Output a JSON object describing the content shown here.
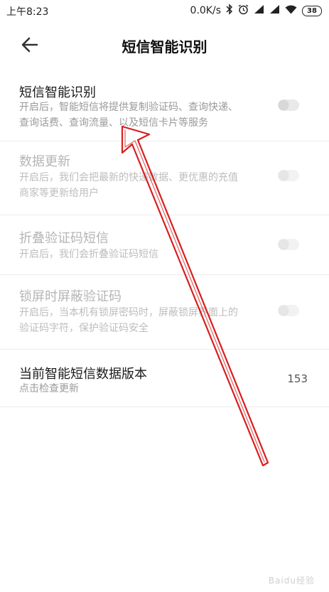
{
  "status_bar": {
    "time": "上午8:23",
    "network_speed": "0.0K/s",
    "battery": "38",
    "icons": [
      "bluetooth-icon",
      "alarm-icon",
      "signal-icon",
      "signal-icon",
      "wifi-icon",
      "battery-icon"
    ]
  },
  "header": {
    "title": "短信智能识别",
    "back_icon": "back-arrow-icon"
  },
  "settings": [
    {
      "title": "短信智能识别",
      "desc_line1": "开启后，智能短信将提供复制验证码、查询快递、",
      "desc_line2": "查询话费、查询流量、以及短信卡片等服务",
      "enabled": true,
      "toggle_on": false
    },
    {
      "title": "数据更新",
      "desc_line1": "开启后，我们会把最新的快递数据、更优惠的充值",
      "desc_line2": "商家等更新给用户",
      "enabled": false,
      "toggle_on": false
    },
    {
      "title": "折叠验证码短信",
      "desc_line1": "开启后，我们会折叠验证码短信",
      "enabled": false,
      "toggle_on": false
    },
    {
      "title": "锁屏时屏蔽验证码",
      "desc_line1": "开启后，当本机有锁屏密码时，屏蔽锁屏界面上的",
      "desc_line2": "验证码字符，保护验证码安全",
      "enabled": false,
      "toggle_on": false
    }
  ],
  "version": {
    "title": "当前智能短信数据版本",
    "subtitle": "点击检查更新",
    "value": "153"
  },
  "watermark": "Baidu经验",
  "colors": {
    "annotation_arrow": "#d81e1e",
    "disabled_text": "#b5b5b5",
    "secondary_text": "#9a9a9a"
  }
}
